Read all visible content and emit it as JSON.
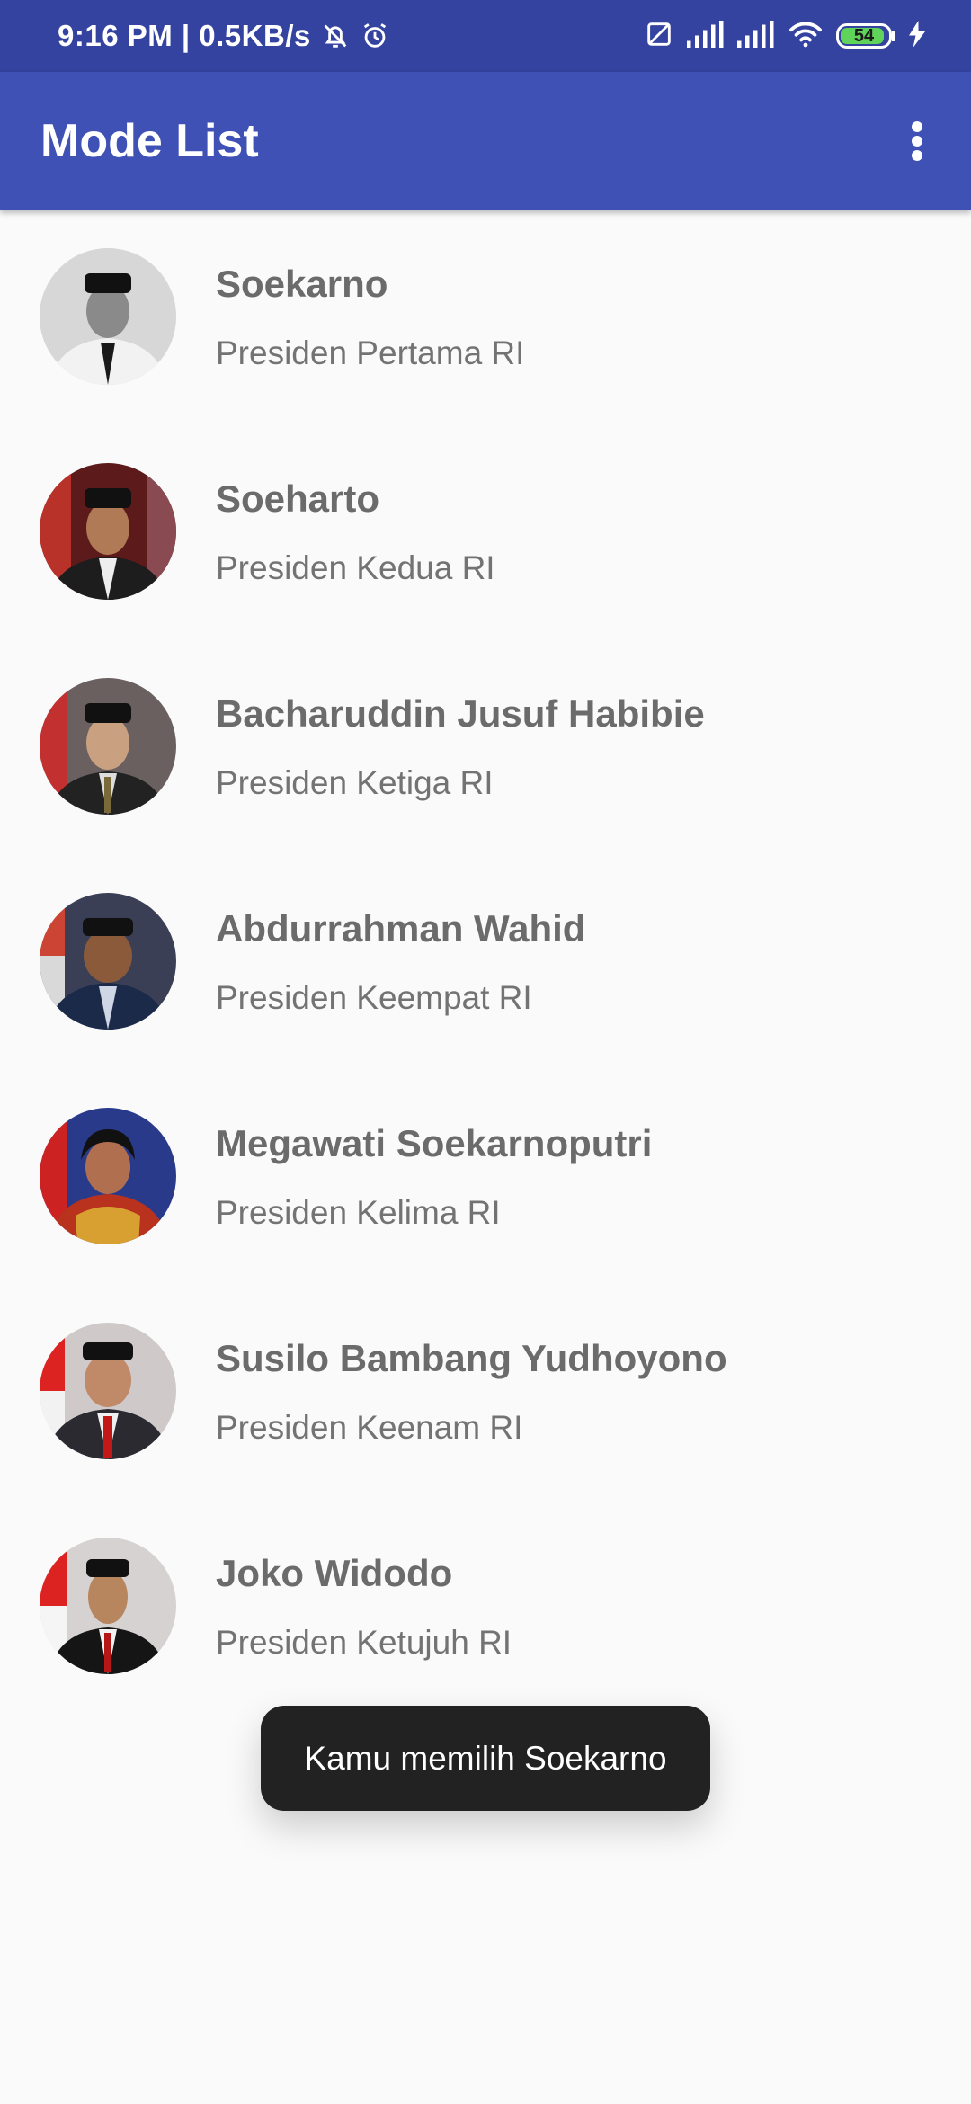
{
  "status_bar": {
    "time_speed": "9:16 PM | 0.5KB/s",
    "battery_level": "54",
    "icons": [
      "mute-bell-icon",
      "alarm-icon",
      "sim-off-icon",
      "signal-icon",
      "signal-icon",
      "wifi-icon",
      "battery-icon",
      "charging-icon"
    ]
  },
  "app_bar": {
    "title": "Mode List",
    "menu_icon": "more-vert-icon"
  },
  "presidents": [
    {
      "name": "Soekarno",
      "role": "Presiden Pertama RI"
    },
    {
      "name": "Soeharto",
      "role": "Presiden Kedua RI"
    },
    {
      "name": "Bacharuddin Jusuf Habibie",
      "role": "Presiden Ketiga RI"
    },
    {
      "name": "Abdurrahman Wahid",
      "role": "Presiden Keempat RI"
    },
    {
      "name": "Megawati Soekarnoputri",
      "role": "Presiden Kelima RI"
    },
    {
      "name": "Susilo Bambang Yudhoyono",
      "role": "Presiden Keenam RI"
    },
    {
      "name": "Joko Widodo",
      "role": "Presiden Ketujuh RI"
    }
  ],
  "toast": {
    "message": "Kamu memilih Soekarno"
  },
  "colors": {
    "status_bar": "#3443a0",
    "app_bar": "#3f51b5",
    "background": "#fafafa",
    "toast": "#222222"
  }
}
